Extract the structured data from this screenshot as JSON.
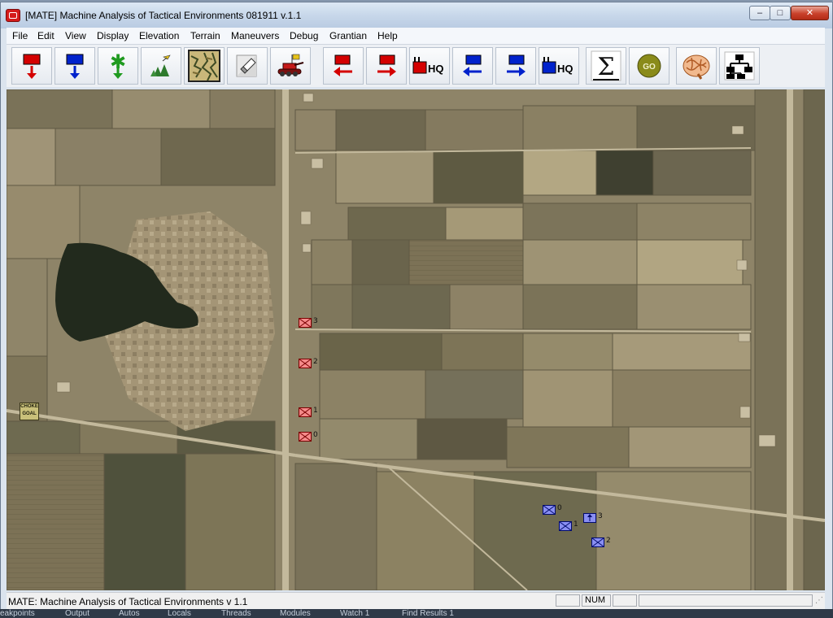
{
  "window": {
    "title": "[MATE] Machine Analysis of Tactical Environments  081911 v.1.1",
    "controls": {
      "minimize": "–",
      "maximize": "□",
      "close": "✕"
    }
  },
  "menu": {
    "items": [
      "File",
      "Edit",
      "View",
      "Display",
      "Elevation",
      "Terrain",
      "Maneuvers",
      "Debug",
      "Grantian",
      "Help"
    ]
  },
  "toolbar": {
    "buttons": [
      {
        "name": "red-unit-down",
        "icon": "red-flag-down-arrow-icon"
      },
      {
        "name": "blue-unit-down",
        "icon": "blue-flag-down-arrow-icon"
      },
      {
        "name": "vegetation",
        "icon": "green-asterisk-icon"
      },
      {
        "name": "trees",
        "icon": "trees-icon"
      },
      {
        "name": "terrain-map",
        "icon": "map-thumbnail-icon"
      },
      {
        "name": "eraser",
        "icon": "eraser-icon"
      },
      {
        "name": "tank",
        "icon": "tank-icon"
      },
      {
        "name": "red-move-left",
        "icon": "red-left-arrow-icon"
      },
      {
        "name": "red-move-right",
        "icon": "red-right-arrow-icon"
      },
      {
        "name": "red-hq",
        "icon": "red-hq-icon",
        "label": "HQ"
      },
      {
        "name": "blue-move-left",
        "icon": "blue-left-arrow-icon"
      },
      {
        "name": "blue-move-right",
        "icon": "blue-right-arrow-icon"
      },
      {
        "name": "blue-hq",
        "icon": "blue-hq-icon",
        "label": "HQ"
      },
      {
        "name": "sum",
        "icon": "sigma-icon",
        "label": "Σ"
      },
      {
        "name": "go",
        "icon": "go-icon",
        "label": "GO"
      },
      {
        "name": "brain",
        "icon": "brain-icon"
      },
      {
        "name": "hierarchy",
        "icon": "org-chart-icon"
      }
    ]
  },
  "map": {
    "choke_label": [
      "CHOKE",
      "GOAL"
    ],
    "red_units": [
      {
        "id": "3"
      },
      {
        "id": "2"
      },
      {
        "id": "1"
      },
      {
        "id": "0"
      }
    ],
    "blue_units": [
      {
        "id": "0"
      },
      {
        "id": "1"
      },
      {
        "id": "2"
      },
      {
        "id": "3"
      }
    ]
  },
  "status": {
    "text": "MATE: Machine Analysis of Tactical Environments v 1.1",
    "num": "NUM"
  },
  "taskbar_bottom": [
    "eakpoints",
    "Output",
    "Autos",
    "Locals",
    "Threads",
    "Modules",
    "Watch 1",
    "Find Results 1"
  ]
}
